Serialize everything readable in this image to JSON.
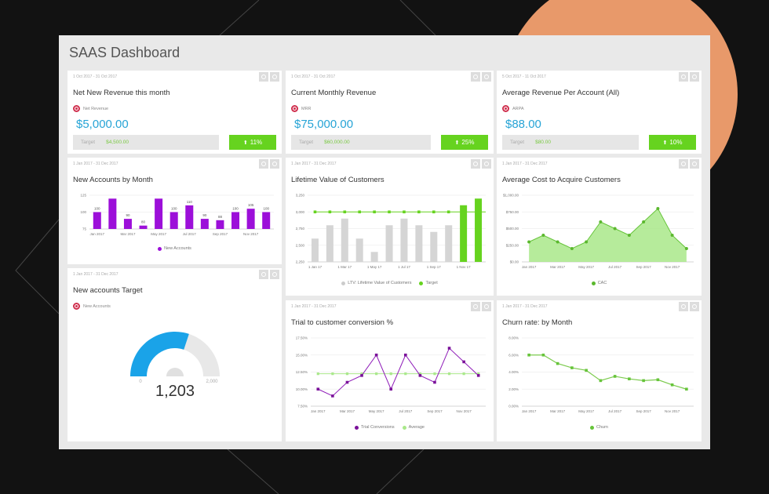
{
  "dashboard": {
    "title": "SAAS Dashboard"
  },
  "colors": {
    "accent_blue": "#27a4d6",
    "green": "#66d31f",
    "purple": "#9c0fd9",
    "grey_bar": "#d5d5d5",
    "target_red": "#d0314f"
  },
  "kpis": [
    {
      "date_range": "1 Oct 2017 - 31 Oct 2017",
      "title": "Net New Revenue this month",
      "metric": "Net Revenue",
      "value": "$5,000.00",
      "target_label": "Target",
      "target_value": "$4,500.00",
      "change": "11%",
      "change_icon": "arrow-up-icon"
    },
    {
      "date_range": "1 Oct 2017 - 31 Oct 2017",
      "title": "Current Monthly Revenue",
      "metric": "MRR",
      "value": "$75,000.00",
      "target_label": "Target",
      "target_value": "$60,000.00",
      "change": "25%",
      "change_icon": "arrow-up-icon"
    },
    {
      "date_range": "5 Oct 2017 - 11 Oct 2017",
      "title": "Average Revenue Per Account (All)",
      "metric": "ARPA",
      "value": "$88.00",
      "target_label": "Target",
      "target_value": "$80.00",
      "change": "10%",
      "change_icon": "arrow-up-icon"
    }
  ],
  "gauge": {
    "date_range": "1 Jan 2017 - 31 Dec 2017",
    "title": "New accounts Target",
    "metric": "New Accounts",
    "value_label": "1,203",
    "value": 1203,
    "min": 0,
    "max": 2000,
    "min_label": "0",
    "max_label": "2,000"
  },
  "chart_data": [
    {
      "id": "new_accounts",
      "type": "bar",
      "date_range": "1 Jan 2017 - 31 Dec 2017",
      "title": "New Accounts by Month",
      "categories": [
        "Jan 2017",
        "Feb 2017",
        "Mar 2017",
        "Apr 2017",
        "May 2017",
        "Jun 2017",
        "Jul 2017",
        "Aug 2017",
        "Sep 2017",
        "Oct 2017",
        "Nov 2017",
        "Dec 2017"
      ],
      "tick_labels": [
        "Jan 2017",
        "",
        "Mar 2017",
        "",
        "May 2017",
        "",
        "Jul 2017",
        "",
        "Sep 2017",
        "",
        "Nov 2017",
        ""
      ],
      "series": [
        {
          "name": "New Accounts",
          "values": [
            100,
            120,
            90,
            80,
            120,
            100,
            110,
            90,
            88,
            100,
            105,
            100
          ]
        }
      ],
      "data_labels": [
        "100",
        "",
        "90",
        "80",
        "",
        "100",
        "110",
        "90",
        "88",
        "100",
        "105",
        "100"
      ],
      "ylim": [
        75,
        125
      ],
      "yticks": [
        "75",
        "100",
        "125"
      ],
      "legend": "bottom",
      "grid": true
    },
    {
      "id": "ltv",
      "type": "bar",
      "date_range": "1 Jan 2017 - 31 Dec 2017",
      "title": "Lifetime Value of Customers",
      "categories": [
        "1 Jan 17",
        "1 Feb 17",
        "1 Mar 17",
        "1 Apr 17",
        "1 May 17",
        "1 Jun 17",
        "1 Jul 17",
        "1 Aug 17",
        "1 Sep 17",
        "1 Oct 17",
        "1 Nov 17",
        "1 Dec 17"
      ],
      "tick_labels": [
        "1 Jan 17",
        "",
        "1 Mar 17",
        "",
        "1 May 17",
        "",
        "1 Jul 17",
        "",
        "1 Sep 17",
        "",
        "1 Nov 17",
        ""
      ],
      "series": [
        {
          "name": "LTV: Lifetime Value of Customers",
          "values": [
            2600,
            2800,
            2900,
            2600,
            2400,
            2800,
            2900,
            2800,
            2700,
            2800,
            3100,
            3200
          ]
        },
        {
          "name": "Target",
          "type": "line",
          "values": [
            3000,
            3000,
            3000,
            3000,
            3000,
            3000,
            3000,
            3000,
            3000,
            3000,
            3000,
            3000
          ]
        }
      ],
      "ylim": [
        2250,
        3250
      ],
      "yticks": [
        "2,250",
        "2,500",
        "2,750",
        "3,000",
        "3,250"
      ],
      "legend": "bottom",
      "grid": true
    },
    {
      "id": "cac",
      "type": "area",
      "date_range": "1 Jan 2017 - 31 Dec 2017",
      "title": "Average Cost to Acquire Customers",
      "categories": [
        "Jan 2017",
        "Feb 2017",
        "Mar 2017",
        "Apr 2017",
        "May 2017",
        "Jun 2017",
        "Jul 2017",
        "Aug 2017",
        "Sep 2017",
        "Oct 2017",
        "Nov 2017",
        "Dec 2017"
      ],
      "tick_labels": [
        "Jan 2017",
        "",
        "Mar 2017",
        "",
        "May 2017",
        "",
        "Jul 2017",
        "",
        "Sep 2017",
        "",
        "Nov 2017",
        ""
      ],
      "series": [
        {
          "name": "CAC",
          "values": [
            300,
            400,
            300,
            200,
            300,
            600,
            500,
            400,
            600,
            800,
            400,
            200
          ]
        }
      ],
      "ylim": [
        0,
        1000
      ],
      "yticks": [
        "$0.00",
        "$250.00",
        "$500.00",
        "$750.00",
        "$1,000.00"
      ],
      "legend": "bottom",
      "grid": true
    },
    {
      "id": "trial",
      "type": "line",
      "date_range": "1 Jan 2017 - 31 Dec 2017",
      "title": "Trial to customer conversion %",
      "categories": [
        "Jan 2017",
        "Feb 2017",
        "Mar 2017",
        "Apr 2017",
        "May 2017",
        "Jun 2017",
        "Jul 2017",
        "Aug 2017",
        "Sep 2017",
        "Oct 2017",
        "Nov 2017",
        "Dec 2017"
      ],
      "tick_labels": [
        "Jan 2017",
        "",
        "Mar 2017",
        "",
        "May 2017",
        "",
        "Jul 2017",
        "",
        "Sep 2017",
        "",
        "Nov 2017",
        ""
      ],
      "series": [
        {
          "name": "Trial Conversions",
          "values": [
            10,
            9,
            11,
            12,
            15,
            10,
            15,
            12,
            11,
            16,
            14,
            12
          ]
        },
        {
          "name": "Average",
          "values": [
            12.25,
            12.25,
            12.25,
            12.25,
            12.25,
            12.25,
            12.25,
            12.25,
            12.25,
            12.25,
            12.25,
            12.25
          ]
        }
      ],
      "ylim": [
        7.5,
        17.5
      ],
      "yticks": [
        "7.50%",
        "10.00%",
        "12.50%",
        "15.00%",
        "17.50%"
      ],
      "legend": "bottom",
      "grid": true
    },
    {
      "id": "churn",
      "type": "line",
      "date_range": "1 Jan 2017 - 31 Dec 2017",
      "title": "Churn rate: by Month",
      "categories": [
        "Jan 2017",
        "Feb 2017",
        "Mar 2017",
        "Apr 2017",
        "May 2017",
        "Jun 2017",
        "Jul 2017",
        "Aug 2017",
        "Sep 2017",
        "Oct 2017",
        "Nov 2017",
        "Dec 2017"
      ],
      "tick_labels": [
        "Jan 2017",
        "",
        "Mar 2017",
        "",
        "May 2017",
        "",
        "Jul 2017",
        "",
        "Sep 2017",
        "",
        "Nov 2017",
        ""
      ],
      "series": [
        {
          "name": "Churn",
          "values": [
            6,
            6,
            5,
            4.5,
            4.2,
            3,
            3.5,
            3.2,
            3,
            3.1,
            2.5,
            2
          ]
        }
      ],
      "ylim": [
        0,
        8
      ],
      "yticks": [
        "0.00%",
        "2.00%",
        "4.00%",
        "6.00%",
        "8.00%"
      ],
      "legend": "bottom",
      "grid": true
    }
  ]
}
